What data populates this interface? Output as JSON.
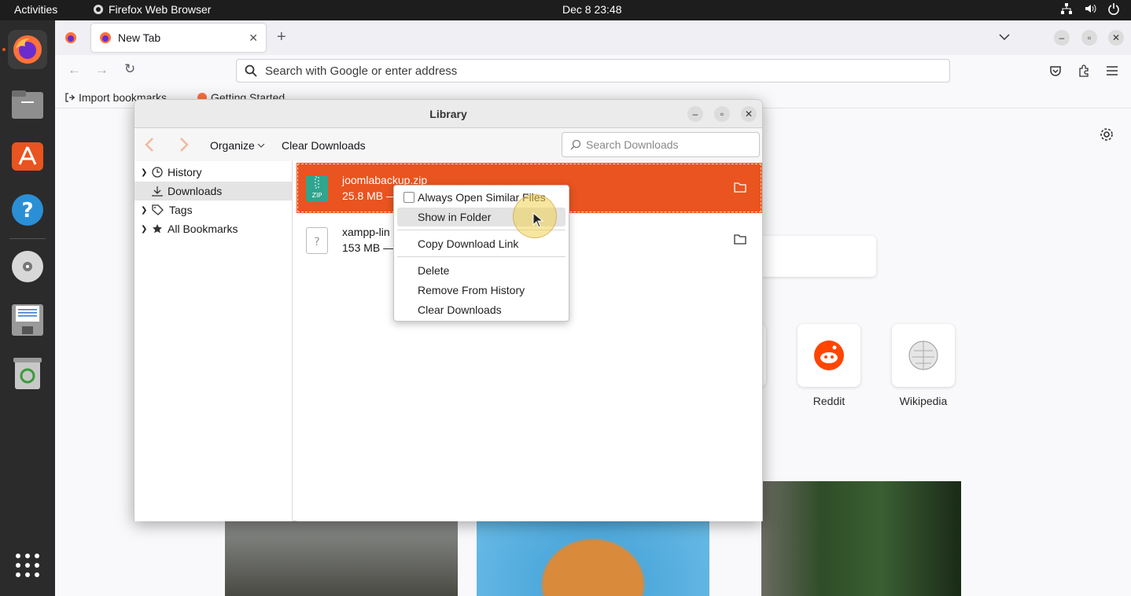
{
  "topbar": {
    "activities": "Activities",
    "app_name": "Firefox Web Browser",
    "clock": "Dec 8  23:48"
  },
  "dock": {
    "items": [
      "firefox-icon",
      "files-icon",
      "app-center-icon",
      "help-icon",
      "disc-icon",
      "save-icon",
      "trash-icon",
      "apps-grid-icon"
    ]
  },
  "browser": {
    "tab_title": "New Tab",
    "url_placeholder": "Search with Google or enter address",
    "bookmarks": [
      "Import bookmarks",
      "Getting Started"
    ],
    "topsites": [
      {
        "label": "Reddit"
      },
      {
        "label": "Wikipedia"
      }
    ]
  },
  "library": {
    "title": "Library",
    "toolbar": {
      "organize": "Organize",
      "clear_downloads": "Clear Downloads",
      "search_placeholder": "Search Downloads"
    },
    "sidebar": [
      {
        "label": "History",
        "icon": "clock-icon",
        "expandable": true
      },
      {
        "label": "Downloads",
        "icon": "download-icon",
        "expandable": false,
        "selected": true
      },
      {
        "label": "Tags",
        "icon": "tag-icon",
        "expandable": true
      },
      {
        "label": "All Bookmarks",
        "icon": "star-icon",
        "expandable": true
      }
    ],
    "downloads": [
      {
        "name": "joomlabackup.zip",
        "meta": "25.8 MB —",
        "selected": true
      },
      {
        "name": "xampp-lin",
        "meta": "153 MB —",
        "selected": false
      }
    ]
  },
  "context_menu": {
    "items": [
      {
        "label": "Always Open Similar Files",
        "type": "checkbox",
        "checked": false
      },
      {
        "label": "Show in Folder",
        "hovered": true
      },
      {
        "label": "Copy Download Link"
      },
      {
        "label": "Delete"
      },
      {
        "label": "Remove From History"
      },
      {
        "label": "Clear Downloads"
      }
    ]
  },
  "colors": {
    "accent": "#e95420",
    "topbar": "#1d1d1d",
    "dock": "#2b2b2b"
  }
}
